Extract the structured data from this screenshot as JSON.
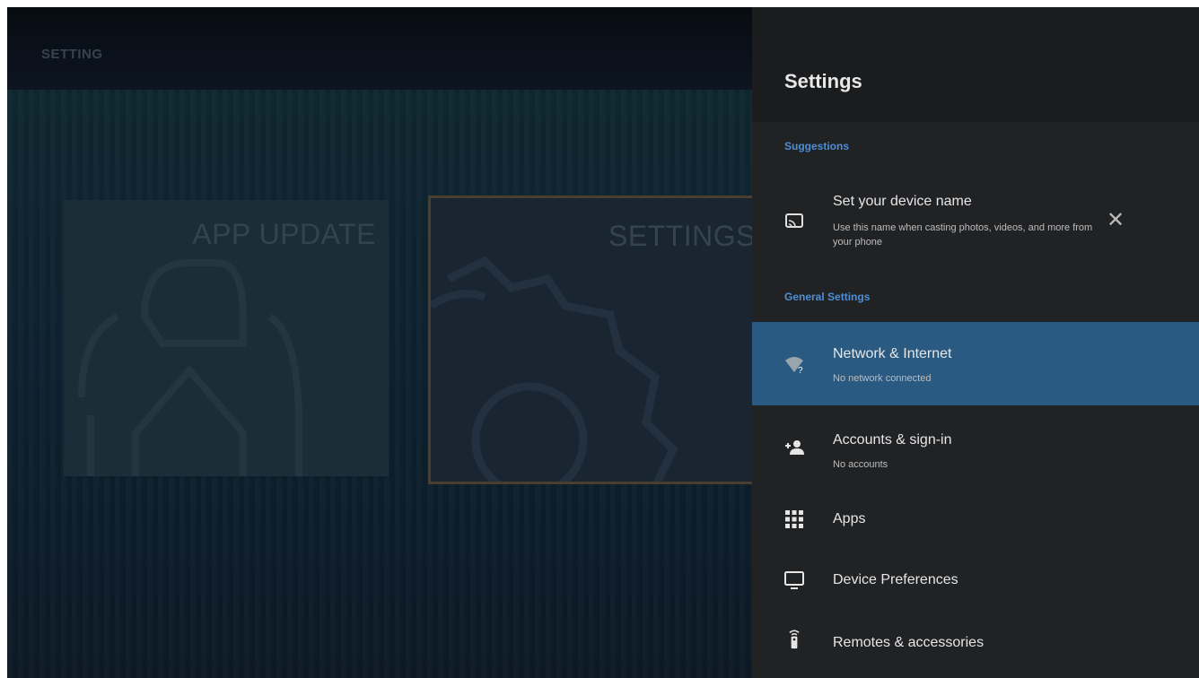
{
  "app": {
    "title": "SETTING"
  },
  "tiles": [
    {
      "label": "APP UPDATE",
      "icon": "update-icon"
    },
    {
      "label": "SETTINGS",
      "icon": "gear-icon"
    }
  ],
  "panel": {
    "title": "Settings",
    "suggestions_header": "Suggestions",
    "suggestion": {
      "title": "Set your device name",
      "subtitle": "Use this name when casting photos, videos, and more from your phone",
      "icon": "cast-icon",
      "dismiss_icon": "close-icon"
    },
    "general_header": "General Settings",
    "items": [
      {
        "title": "Network & Internet",
        "subtitle": "No network connected",
        "icon": "wifi-question-icon",
        "selected": true
      },
      {
        "title": "Accounts & sign-in",
        "subtitle": "No accounts",
        "icon": "add-person-icon"
      },
      {
        "title": "Apps",
        "icon": "grid-icon"
      },
      {
        "title": "Device Preferences",
        "icon": "tv-icon"
      },
      {
        "title": "Remotes & accessories",
        "icon": "remote-icon"
      }
    ]
  },
  "colors": {
    "accent": "#4d8fd8",
    "selected": "#2a5a82",
    "panel": "#212224"
  }
}
